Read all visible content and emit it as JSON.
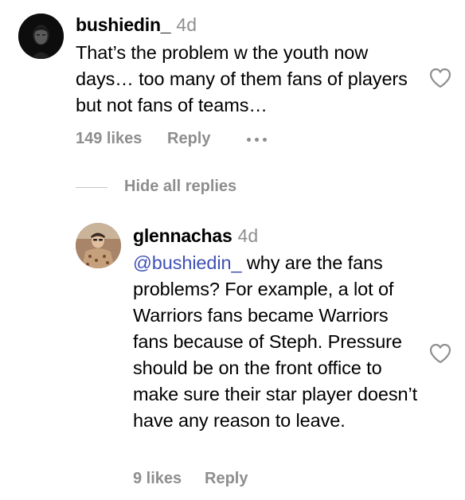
{
  "comment": {
    "username": "bushiedin_",
    "time": "4d",
    "text": "That’s the problem w the youth now days… too many of them fans of players but not fans of teams…",
    "likes": "149 likes",
    "reply_label": "Reply",
    "more_icon": "more-horizontal-icon",
    "like_icon": "heart-outline-icon"
  },
  "replies_toggle": {
    "label": "Hide all replies"
  },
  "reply": {
    "username": "glennachas",
    "time": "4d",
    "mention": "@bushiedin_",
    "text": " why are the fans problems? For example, a lot of Warriors fans became Warriors fans because of Steph. Pressure should be on the front office to make sure their star player doesn’t have any reason to leave.",
    "likes": "9 likes",
    "reply_label": "Reply",
    "like_icon": "heart-outline-icon"
  },
  "colors": {
    "text": "#000000",
    "muted": "#8e8e8e",
    "mention": "#4051b5",
    "divider": "#c7c7c7"
  }
}
